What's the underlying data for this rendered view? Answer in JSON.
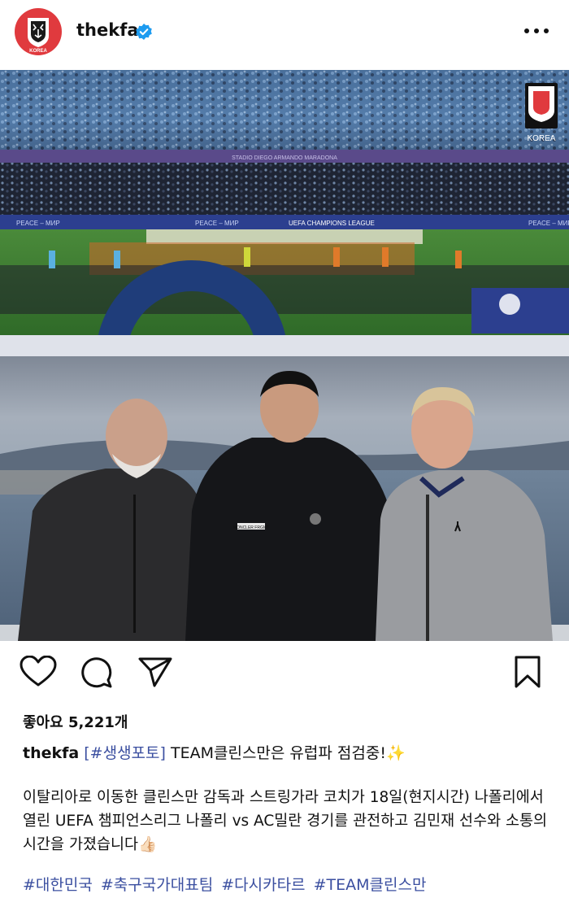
{
  "header": {
    "username": "thekfa",
    "verified": true,
    "avatar_text": "KOREA",
    "more_icon": "more-horizontal-icon"
  },
  "photo_top": {
    "board_left": "PEACE – МИР",
    "board_mid": "PEACE – МИР",
    "board_center": "UEFA CHAMPIONS LEAGUE",
    "board_right": "PEACE – МИР",
    "stand_text": "STADIO DIEGO ARMANDO MARADONA",
    "watermark": "KOREA"
  },
  "photo_bottom": {
    "hoodie_text": "MONCLER FRGMT"
  },
  "actions": {
    "like_icon": "heart-icon",
    "comment_icon": "comment-icon",
    "share_icon": "send-icon",
    "save_icon": "bookmark-icon"
  },
  "likes": "좋아요 5,221개",
  "caption": {
    "username": "thekfa",
    "tag": "[#생생포토]",
    "title": " TEAM클린스만은 유럽파 점검중!✨",
    "body": "이탈리아로 이동한 클린스만 감독과 스트링가라 코치가 18일(현지시간) 나폴리에서 열린 UEFA 챔피언스리그 나폴리 vs AC밀란 경기를 관전하고 김민재 선수와 소통의 시간을 가졌습니다👍🏻",
    "hashtags": [
      "#대한민국",
      "#축구국가대표팀",
      "#다시카타르",
      "#TEAM클린스만"
    ]
  },
  "colors": {
    "accent": "#3b4fa0",
    "verified": "#1d9bf0",
    "kfa_red": "#e03a3e"
  }
}
